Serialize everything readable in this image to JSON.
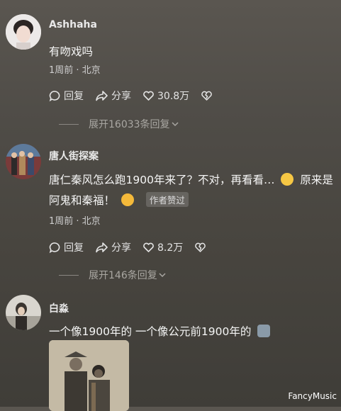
{
  "comments": [
    {
      "username": "Ashhaha",
      "text": "有吻戏吗",
      "meta": "1周前 · 北京",
      "reply_label": "回复",
      "share_label": "分享",
      "likes": "30.8万",
      "expand": "展开16033条回复"
    },
    {
      "username": "唐人街探案",
      "text_line1_a": "唐仁秦风怎么跑1900年来了？不对，再看看…",
      "text_line1_b": "原来是",
      "text_line2": "阿鬼和秦福！",
      "badge": "作者赞过",
      "meta": "1周前 · 北京",
      "reply_label": "回复",
      "share_label": "分享",
      "likes": "8.2万",
      "expand": "展开146条回复"
    },
    {
      "username": "白淼",
      "text": "一个像1900年的  一个像公元前1900年的"
    }
  ],
  "watermark": "FancyMusic",
  "icons": {
    "reply": "speech-bubble-icon",
    "share": "share-arrow-icon",
    "like": "heart-icon",
    "dislike": "broken-heart-icon",
    "expand": "chevron-down-icon"
  }
}
